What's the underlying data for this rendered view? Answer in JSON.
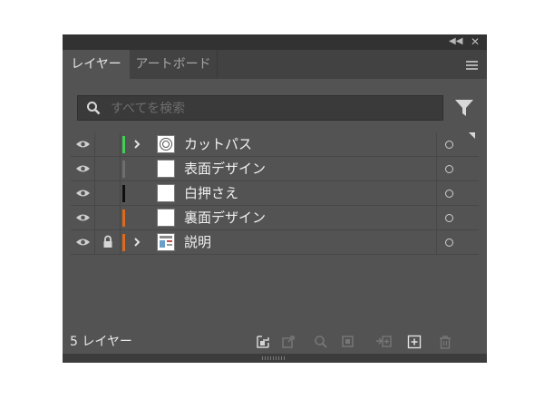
{
  "panel": {
    "tabs": [
      {
        "label": "レイヤー",
        "active": true
      },
      {
        "label": "アートボード",
        "active": false
      }
    ]
  },
  "search": {
    "placeholder": "すべてを検索",
    "value": ""
  },
  "layers": [
    {
      "name": "カットパス",
      "color": "#3fd153",
      "expandable": true,
      "locked": false,
      "visible": true,
      "thumbnail": "target-circle"
    },
    {
      "name": "表面デザイン",
      "color": "#6e6e6e",
      "expandable": false,
      "locked": false,
      "visible": true,
      "thumbnail": "blank"
    },
    {
      "name": "白押さえ",
      "color": "#0f0f0f",
      "expandable": false,
      "locked": false,
      "visible": true,
      "thumbnail": "blank"
    },
    {
      "name": "裏面デザイン",
      "color": "#e06a1b",
      "expandable": false,
      "locked": false,
      "visible": true,
      "thumbnail": "blank"
    },
    {
      "name": "説明",
      "color": "#e06a1b",
      "expandable": true,
      "locked": true,
      "visible": true,
      "thumbnail": "document"
    }
  ],
  "footer": {
    "layer_count": "5 レイヤー"
  },
  "colors": {
    "panel_bg": "#535353",
    "title_bg": "#323232"
  }
}
